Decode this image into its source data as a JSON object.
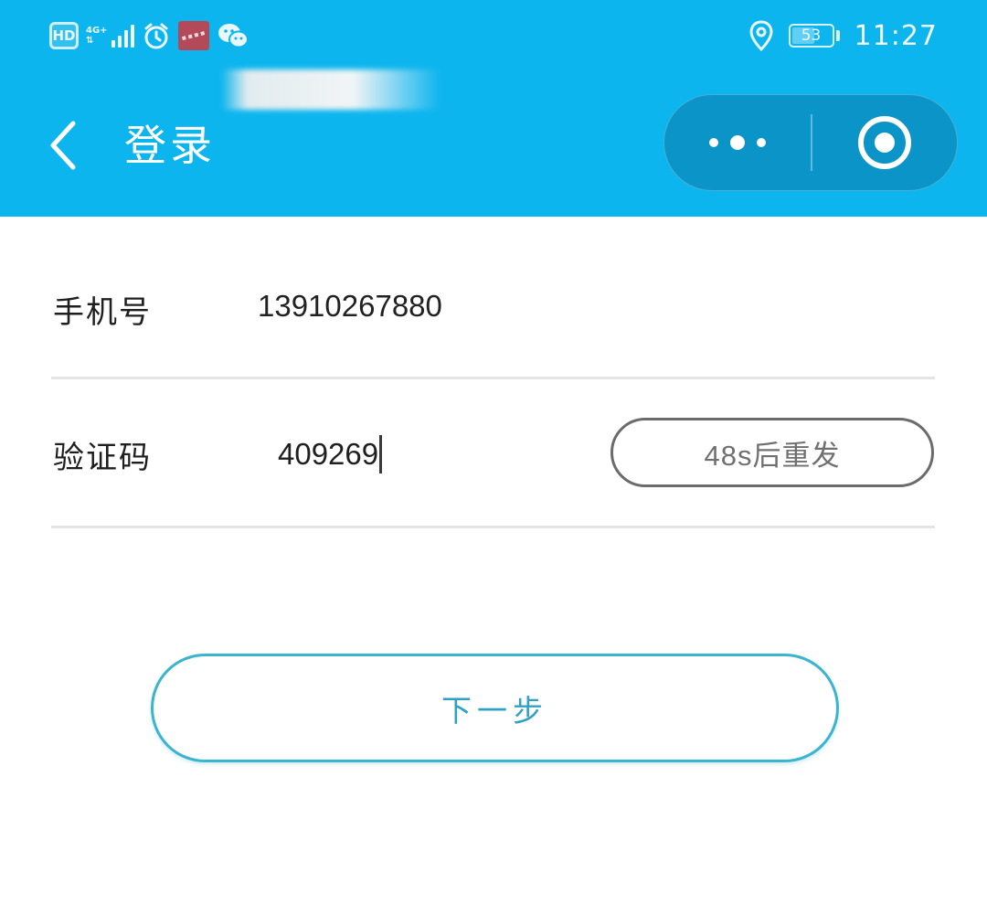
{
  "status_bar": {
    "hd_label": "HD",
    "network_label": "4G+",
    "battery_level": "53",
    "time": "11:27",
    "icons": [
      "hd-icon",
      "signal-icon",
      "alarm-icon",
      "app-thumbnail-icon",
      "wechat-icon",
      "location-icon",
      "battery-icon"
    ]
  },
  "nav": {
    "title": "登录",
    "back_icon": "chevron-left-icon",
    "more_icon": "more-dots-icon",
    "close_icon": "target-close-icon"
  },
  "form": {
    "phone_label": "手机号",
    "phone_value": "13910267880",
    "code_label": "验证码",
    "code_value": "409269",
    "resend_label": "48s后重发"
  },
  "actions": {
    "next_label": "下一步"
  },
  "colors": {
    "header_bg": "#0db5ee",
    "accent": "#3bb4cf",
    "divider": "#e4e4e4"
  }
}
